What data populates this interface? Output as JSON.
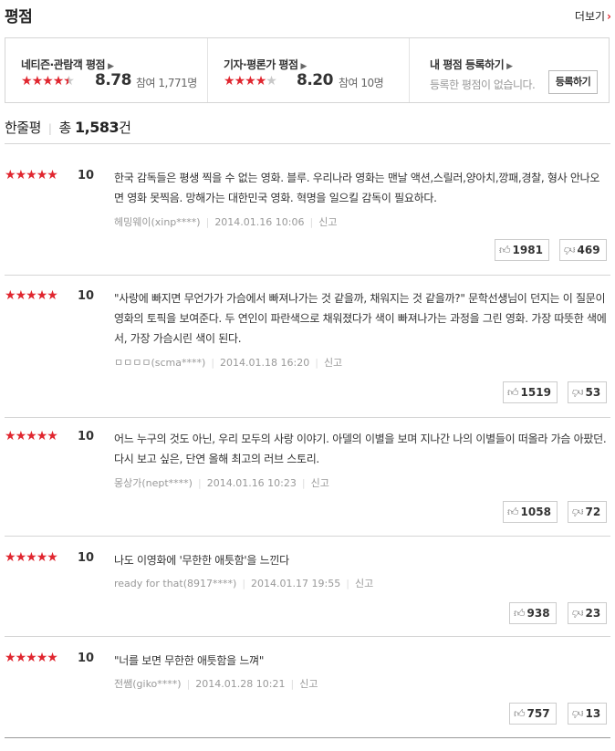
{
  "header": {
    "title": "평점",
    "more_label": "더보기"
  },
  "summary": {
    "netizen": {
      "label": "네티즌·관람객 평점",
      "score": "8.78",
      "count": "참여 1,771명",
      "stars_filled": 4.5
    },
    "critic": {
      "label": "기자·평론가 평점",
      "score": "8.20",
      "count": "참여 10명",
      "stars_filled": 4
    },
    "mine": {
      "label": "내 평점 등록하기",
      "note": "등록한 평점이 없습니다.",
      "button": "등록하기"
    }
  },
  "total": {
    "label": "한줄평",
    "prefix": "총",
    "count": "1,583",
    "suffix": "건"
  },
  "colors": {
    "accent": "#e0262f",
    "star_off": "#c8c8c8"
  },
  "icons": {
    "like": "thumbs-up-icon",
    "dislike": "thumbs-down-icon"
  },
  "reviews": [
    {
      "score": "10",
      "text": "한국 감독들은 평생 찍을 수 없는 영화. 블루. 우리나라 영화는 맨날 액션,스릴러,양아치,깡패,경찰, 형사 안나오면 영화 못찍음. 망해가는 대한민국 영화. 혁명을 일으킬 감독이 필요하다.",
      "author": "헤밍웨이(xinp****)",
      "date": "2014.01.16 10:06",
      "report": "신고",
      "likes": "1981",
      "dislikes": "469"
    },
    {
      "score": "10",
      "text": "\"사랑에 빠지면 무언가가 가슴에서 빠져나가는 것 같을까, 채워지는 것 같을까?\" 문학선생님이 던지는 이 질문이 영화의 토픽을 보여준다. 두 연인이 파란색으로 채워졌다가 색이 빠져나가는 과정을 그린 영화. 가장 따뜻한 색에서, 가장 가슴시린 색이 된다.",
      "author": "ㅁㅁㅁㅁ(scma****)",
      "date": "2014.01.18 16:20",
      "report": "신고",
      "likes": "1519",
      "dislikes": "53"
    },
    {
      "score": "10",
      "text": "어느 누구의 것도 아닌, 우리 모두의 사랑 이야기. 아델의 이별을 보며 지나간 나의 이별들이 떠올라 가슴 아팠던. 다시 보고 싶은, 단연 올해 최고의 러브 스토리.",
      "author": "몽상가(nept****)",
      "date": "2014.01.16 10:23",
      "report": "신고",
      "likes": "1058",
      "dislikes": "72"
    },
    {
      "score": "10",
      "text": "나도 이영화에 '무한한 애틋함'을 느낀다",
      "author": "ready for that(8917****)",
      "date": "2014.01.17 19:55",
      "report": "신고",
      "likes": "938",
      "dislikes": "23"
    },
    {
      "score": "10",
      "text": "\"너를 보면 무한한 애틋함을 느껴\"",
      "author": "전쌤(giko****)",
      "date": "2014.01.28 10:21",
      "report": "신고",
      "likes": "757",
      "dislikes": "13"
    }
  ]
}
